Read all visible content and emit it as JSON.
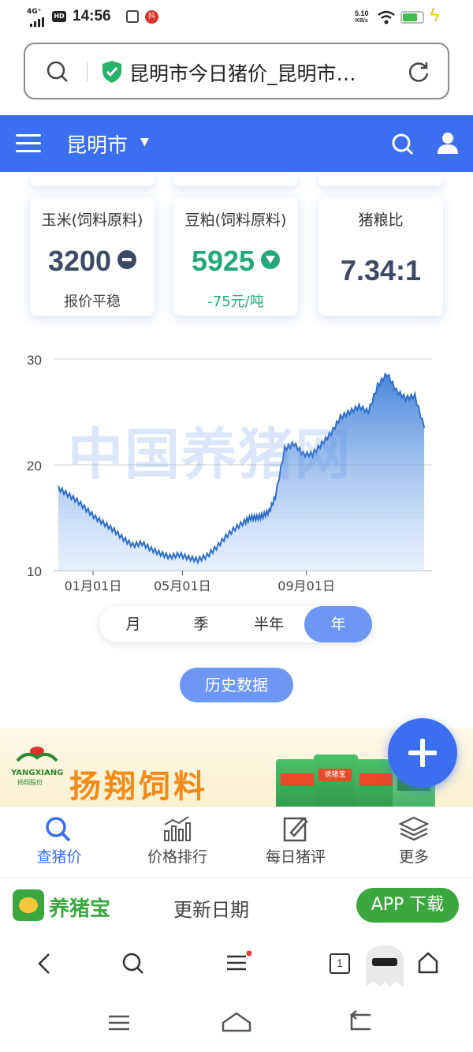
{
  "status_bar": {
    "time": "14:56",
    "signal_label": "4G⁺",
    "hd_badge": "HD",
    "notif_badge": "抖",
    "net_speed_value": "5.10",
    "net_speed_unit": "KB/s",
    "battery_level": 0.7,
    "icons": [
      "signal-icon",
      "hd-icon",
      "app-notification-icon",
      "wifi-icon",
      "battery-icon",
      "charging-icon"
    ]
  },
  "address_bar": {
    "title": "昆明市今日猪价_昆明市…"
  },
  "nav": {
    "city": "昆明市"
  },
  "cards": [
    {
      "name": "玉米(饲料原料)",
      "value": "3200",
      "sub": "报价平稳",
      "color": "#3d4a66"
    },
    {
      "name": "豆粕(饲料原料)",
      "value": "5925",
      "sub": "-75元/吨",
      "color": "#25a97a"
    },
    {
      "name": "猪粮比",
      "value": "7.34:1",
      "sub": "",
      "color": "#3d4a66"
    }
  ],
  "chart_watermark": "中国养猪网",
  "chart_data": {
    "type": "area",
    "x_ticks": [
      "01月01日",
      "05月01日",
      "09月01日"
    ],
    "y_ticks": [
      "30",
      "20",
      "10"
    ],
    "ylim": [
      10,
      30
    ],
    "grid": true,
    "x_month": [
      0,
      0.3,
      0.6,
      0.9,
      1.2,
      1.5,
      1.8,
      2.1,
      2.4,
      2.7,
      3.0,
      3.3,
      3.6,
      3.9,
      4.2,
      4.5,
      4.8,
      5.1,
      5.4,
      5.7,
      6.0,
      6.2,
      6.4,
      6.6,
      6.8,
      7.0,
      7.3,
      7.6,
      7.9,
      8.2,
      8.5,
      8.8,
      9.1,
      9.4,
      9.7,
      10.0,
      10.3,
      10.6,
      10.9,
      11.2,
      11.5,
      11.8
    ],
    "values": [
      17.8,
      17.2,
      16.6,
      15.8,
      15.0,
      14.4,
      13.8,
      13.0,
      12.4,
      12.6,
      12.0,
      11.6,
      11.3,
      11.5,
      11.2,
      11.0,
      11.4,
      12.2,
      13.2,
      14.0,
      14.6,
      15.0,
      15.0,
      15.2,
      15.6,
      17.0,
      21.5,
      22.0,
      21.0,
      21.0,
      22.0,
      23.0,
      24.5,
      25.0,
      25.5,
      25.0,
      27.5,
      28.6,
      27.0,
      26.3,
      26.5,
      23.5
    ]
  },
  "segments": [
    {
      "label": "月",
      "active": false
    },
    {
      "label": "季",
      "active": false
    },
    {
      "label": "半年",
      "active": false
    },
    {
      "label": "年",
      "active": true
    }
  ],
  "history_button": "历史数据",
  "ad": {
    "logo_text": "YANGXIANG",
    "logo_sub": "扬翔股份",
    "brand": "扬翔饲料",
    "bag_label": "诱猪宝"
  },
  "tabs": [
    {
      "label": "查猪价",
      "icon": "magnifier-icon",
      "active": true
    },
    {
      "label": "价格排行",
      "icon": "bar-trend-icon",
      "active": false
    },
    {
      "label": "每日猪评",
      "icon": "edit-note-icon",
      "active": false
    },
    {
      "label": "更多",
      "icon": "layers-icon",
      "active": false
    }
  ],
  "app_banner": {
    "name": "养猪宝",
    "update_label": "更新日期",
    "download_label": "APP 下载"
  },
  "browser_bar": {
    "tab_count": "1"
  }
}
